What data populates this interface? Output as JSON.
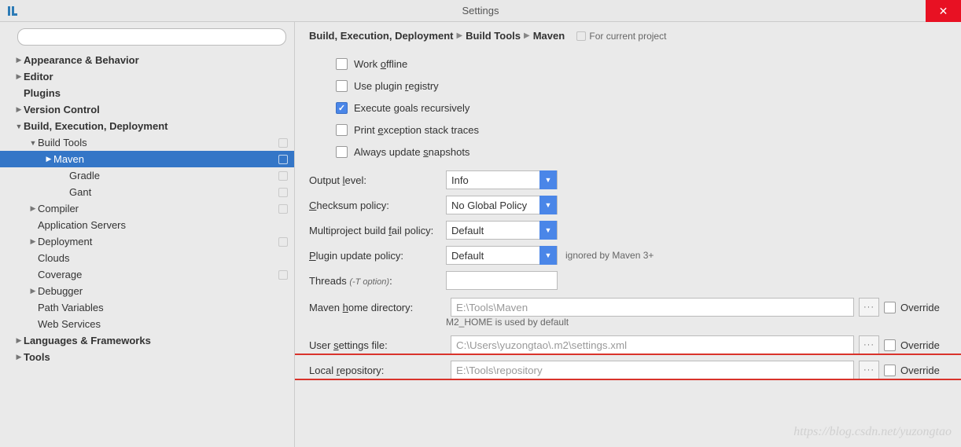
{
  "window": {
    "title": "Settings"
  },
  "breadcrumb": {
    "a": "Build, Execution, Deployment",
    "b": "Build Tools",
    "c": "Maven",
    "note": "For current project"
  },
  "tree": {
    "appearance": "Appearance & Behavior",
    "editor": "Editor",
    "plugins": "Plugins",
    "vcs": "Version Control",
    "bed": "Build, Execution, Deployment",
    "buildtools": "Build Tools",
    "maven": "Maven",
    "gradle": "Gradle",
    "gant": "Gant",
    "compiler": "Compiler",
    "appservers": "Application Servers",
    "deployment": "Deployment",
    "clouds": "Clouds",
    "coverage": "Coverage",
    "debugger": "Debugger",
    "pathvars": "Path Variables",
    "webservices": "Web Services",
    "langfw": "Languages & Frameworks",
    "tools": "Tools"
  },
  "checks": {
    "offline": "Work offline",
    "registry": "Use plugin registry",
    "recursive": "Execute goals recursively",
    "stacktrace": "Print exception stack traces",
    "snapshots": "Always update snapshots"
  },
  "labels": {
    "output": "Output level:",
    "checksum": "Checksum policy:",
    "failpolicy": "Multiproject build fail policy:",
    "pluginupdate": "Plugin update policy:",
    "threads": "Threads ",
    "threads_hint": "(-T option)",
    "mavenhome": "Maven home directory:",
    "mavenhome_hint": "M2_HOME is used by default",
    "usersettings": "User settings file:",
    "localrepo": "Local repository:",
    "override": "Override",
    "ignored": "ignored by Maven 3+"
  },
  "values": {
    "output": "Info",
    "checksum": "No Global Policy",
    "failpolicy": "Default",
    "pluginupdate": "Default",
    "mavenhome": "E:\\Tools\\Maven",
    "usersettings": "C:\\Users\\yuzongtao\\.m2\\settings.xml",
    "localrepo": "E:\\Tools\\repository"
  },
  "watermark": "https://blog.csdn.net/yuzongtao"
}
